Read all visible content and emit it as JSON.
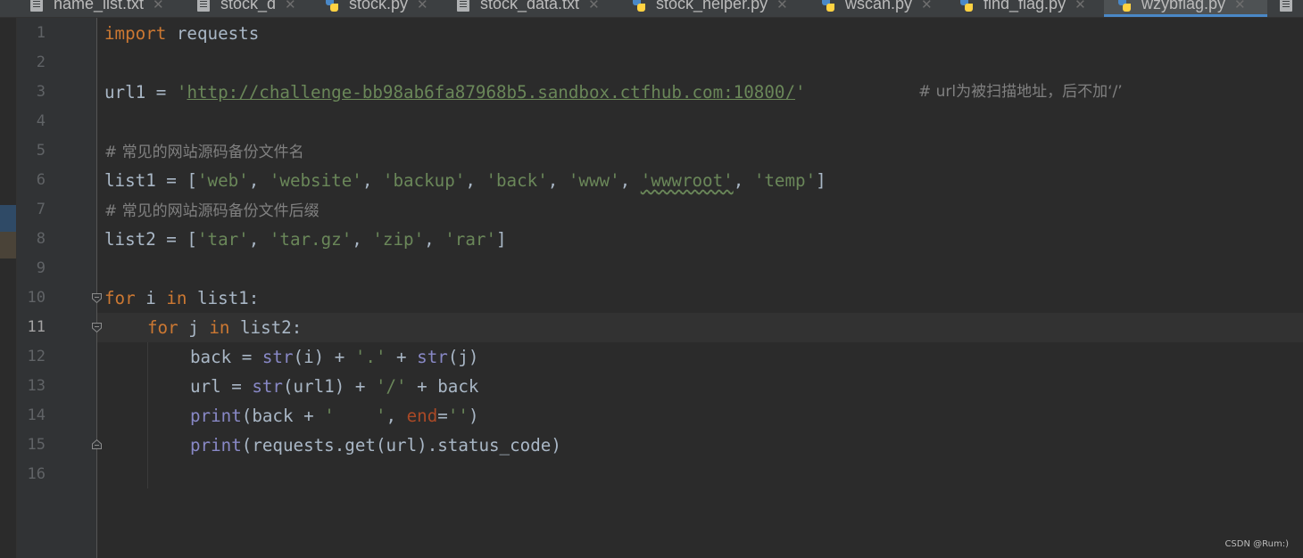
{
  "tabs": [
    {
      "label": "name_list.txt",
      "icon": "text-file-icon"
    },
    {
      "label": "stock_d",
      "icon": "text-file-icon"
    },
    {
      "label": "stock.py",
      "icon": "python-file-icon"
    },
    {
      "label": "stock_data.txt",
      "icon": "text-file-icon"
    },
    {
      "label": "stock_helper.py",
      "icon": "python-file-icon"
    },
    {
      "label": "wscan.py",
      "icon": "python-file-icon"
    },
    {
      "label": "find_flag.py",
      "icon": "python-file-icon"
    },
    {
      "label": "wzybflag.py",
      "icon": "python-file-icon",
      "active": true
    }
  ],
  "editor": {
    "current_line": "11",
    "line_numbers": [
      "1",
      "2",
      "3",
      "4",
      "5",
      "6",
      "7",
      "8",
      "9",
      "10",
      "11",
      "12",
      "13",
      "14",
      "15",
      "16"
    ],
    "code": {
      "l1": {
        "kw": "import",
        "rest": " requests"
      },
      "l3": {
        "var": "url1 = ",
        "q1": "'",
        "url": "http://challenge-bb98ab6fa87968b5.sandbox.ctfhub.com:10800/",
        "q2": "'",
        "comment": "# url为被扫描地址，后不加‘/’"
      },
      "l5": {
        "comment": "# 常见的网站源码备份文件名"
      },
      "l6": {
        "var": "list1 = [",
        "items": [
          "'web'",
          "'website'",
          "'backup'",
          "'back'",
          "'www'",
          "'wwwroot'",
          "'temp'"
        ],
        "close": "]"
      },
      "l7": {
        "comment": "# 常见的网站源码备份文件后缀"
      },
      "l8": {
        "var": "list2 = [",
        "items": [
          "'tar'",
          "'tar.gz'",
          "'zip'",
          "'rar'"
        ],
        "close": "]"
      },
      "l10": {
        "kw1": "for",
        "v": " i ",
        "kw2": "in",
        "rest": " list1:"
      },
      "l11": {
        "kw1": "for",
        "v": " j ",
        "kw2": "in",
        "rest": " list2:"
      },
      "l12": {
        "a": "back = ",
        "fn1": "str",
        "b": "(i) + ",
        "s": "'.'",
        "c": " + ",
        "fn2": "str",
        "d": "(j)"
      },
      "l13": {
        "a": "url = ",
        "fn1": "str",
        "b": "(url1) + ",
        "s": "'/'",
        "c": " + back"
      },
      "l14": {
        "fn": "print",
        "a": "(back + ",
        "s1": "'    '",
        "b": ", ",
        "param": "end",
        "eq": "=",
        "s2": "''",
        "c": ")"
      },
      "l15": {
        "fn": "print",
        "a": "(requests.get(url).status_code)"
      }
    }
  },
  "watermark": "CSDN @Rum:)",
  "colors": {
    "background": "#2b2b2b",
    "keyword": "#cc7832",
    "string": "#6a8759",
    "comment": "#808080",
    "builtin": "#8888c6",
    "param": "#aa4926",
    "tab_accent": "#4a88c7"
  }
}
